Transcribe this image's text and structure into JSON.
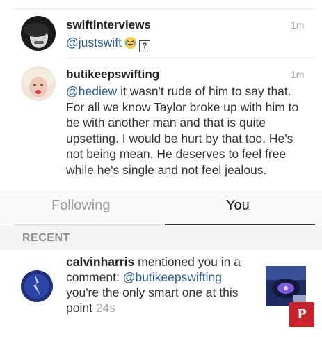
{
  "comments": [
    {
      "username": "swiftinterviews",
      "time": "1m",
      "mention": "@justswift",
      "emoji_icons": [
        "laughing-tears-emoji-icon",
        "missing-glyph-box-icon"
      ],
      "missing_glyph": "?"
    },
    {
      "username": "butikeepswifting",
      "time": "1m",
      "mention": "@hediew",
      "text": " it wasn't rude of him to say that. For all we know Taylor broke up with him to be with another man and that is quite upsetting. I would be hurt by that too. He's not being mean. He deserves to feel free while he's single and not feel jealous."
    }
  ],
  "tabs": {
    "following": "Following",
    "you": "You",
    "active": "you"
  },
  "recent": {
    "header": "RECENT",
    "notification": {
      "username": "calvinharris",
      "action": " mentioned you in a comment: ",
      "mention": "@butikeepswifting",
      "text": " you're the only smart one at this point ",
      "time": "24s"
    }
  },
  "pinterest": {
    "glyph": "P"
  },
  "colors": {
    "mention": "#2d5f93",
    "pinterest": "#c8232c",
    "timestamp": "#a8a8a8"
  }
}
